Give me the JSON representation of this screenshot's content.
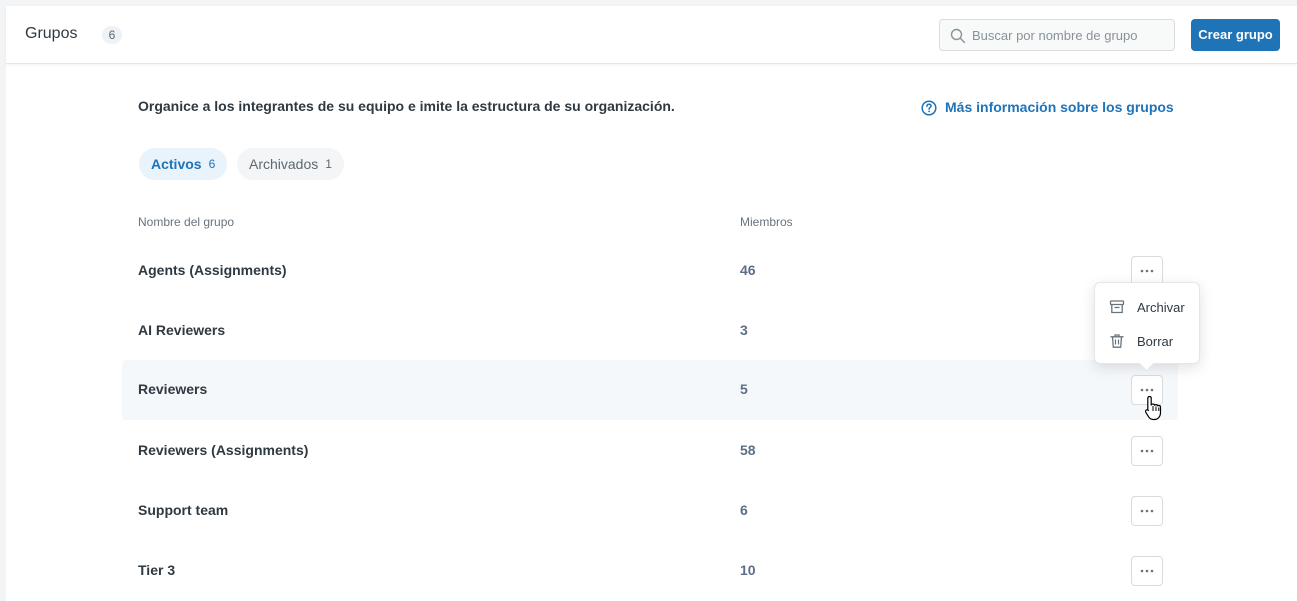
{
  "header": {
    "title": "Grupos",
    "count": "6",
    "search_placeholder": "Buscar por nombre de grupo",
    "create_button": "Crear grupo"
  },
  "description": "Organice a los integrantes de su equipo e imite la estructura de su organización.",
  "info_link": "Más información sobre los grupos",
  "tabs": [
    {
      "label": "Activos",
      "count": "6",
      "active": true
    },
    {
      "label": "Archivados",
      "count": "1",
      "active": false
    }
  ],
  "columns": {
    "name": "Nombre del grupo",
    "members": "Miembros"
  },
  "rows": [
    {
      "name": "Agents (Assignments)",
      "members": "46"
    },
    {
      "name": "AI Reviewers",
      "members": "3"
    },
    {
      "name": "Reviewers",
      "members": "5"
    },
    {
      "name": "Reviewers (Assignments)",
      "members": "58"
    },
    {
      "name": "Support team",
      "members": "6"
    },
    {
      "name": "Tier 3",
      "members": "10"
    }
  ],
  "menu": {
    "archive": "Archivar",
    "delete": "Borrar"
  },
  "colors": {
    "accent": "#1f73b7",
    "hover_row": "#f5f8fb"
  },
  "icons": [
    "search-icon",
    "help-circle-icon",
    "more-horizontal-icon",
    "archive-icon",
    "trash-icon",
    "hand-cursor-icon"
  ]
}
